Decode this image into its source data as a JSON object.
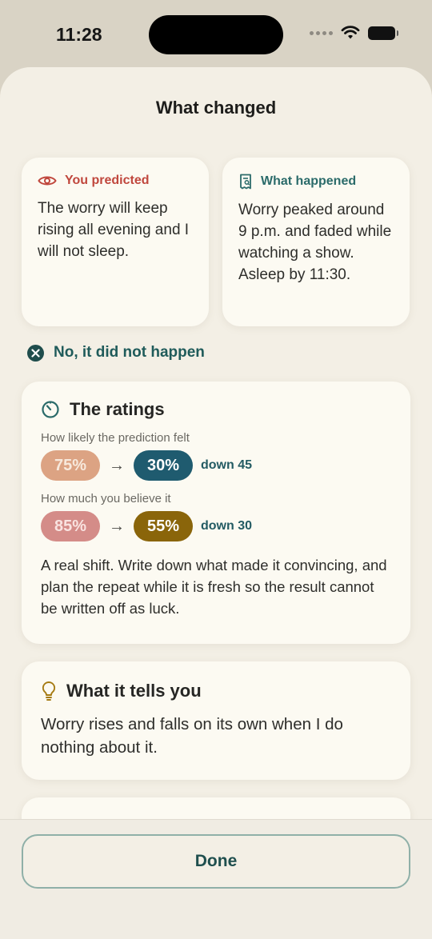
{
  "status_bar": {
    "time": "11:28"
  },
  "sheet": {
    "title": "What changed"
  },
  "prediction": {
    "label": "You predicted",
    "text": "The worry will keep rising all evening and I will not sleep.",
    "icon": "eye-icon"
  },
  "happened": {
    "label": "What happened",
    "text": "Worry peaked around 9 p.m. and faded while watching a show. Asleep by 11:30.",
    "icon": "receipt-icon"
  },
  "outcome": {
    "label": "No, it did not happen",
    "icon": "close-circle-icon"
  },
  "ratings": {
    "title": "The ratings",
    "icon": "gauge-icon",
    "likelihood": {
      "label": "How likely the prediction felt",
      "before": "75%",
      "after": "30%",
      "change": "down 45"
    },
    "belief": {
      "label": "How much you believe it",
      "before": "85%",
      "after": "55%",
      "change": "down 30"
    },
    "arrow": "→",
    "note": "A real shift. Write down what made it convincing, and plan the repeat while it is fresh so the result cannot be written off as luck."
  },
  "tells": {
    "title": "What it tells you",
    "icon": "lightbulb-icon",
    "text": "Worry rises and falls on its own when I do nothing about it."
  },
  "footer": {
    "done_label": "Done"
  },
  "colors": {
    "sheet_background": "#f3efe5",
    "card_background": "#fcfaf2",
    "accent_red": "#c0473d",
    "accent_teal": "#2b6b6a",
    "likelihood_after": "#1f5b6f",
    "belief_after": "#8a650a"
  }
}
